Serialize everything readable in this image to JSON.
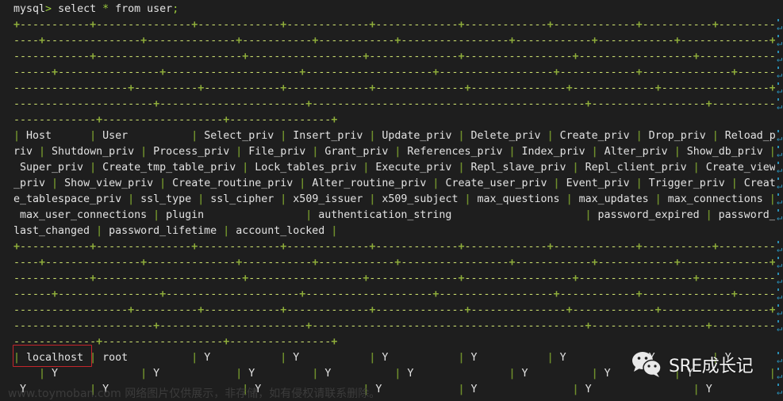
{
  "terminal": {
    "prompt": "mysql>",
    "command": "select * from user;",
    "wrap_width_chars": 120,
    "columns": [
      {
        "name": "Host",
        "width": 9,
        "value": "localhost"
      },
      {
        "name": "User",
        "width": 13,
        "value": "root"
      },
      {
        "name": "Select_priv",
        "width": 11,
        "value": "Y"
      },
      {
        "name": "Insert_priv",
        "width": 11,
        "value": "Y"
      },
      {
        "name": "Update_priv",
        "width": 11,
        "value": "Y"
      },
      {
        "name": "Delete_priv",
        "width": 11,
        "value": "Y"
      },
      {
        "name": "Create_priv",
        "width": 11,
        "value": "Y"
      },
      {
        "name": "Drop_priv",
        "width": 9,
        "value": "Y"
      },
      {
        "name": "Reload_priv",
        "width": 11,
        "value": "Y"
      },
      {
        "name": "Shutdown_priv",
        "width": 13,
        "value": "Y"
      },
      {
        "name": "Process_priv",
        "width": 12,
        "value": "Y"
      },
      {
        "name": "File_priv",
        "width": 9,
        "value": "Y"
      },
      {
        "name": "Grant_priv",
        "width": 10,
        "value": "Y"
      },
      {
        "name": "References_priv",
        "width": 15,
        "value": "Y"
      },
      {
        "name": "Index_priv",
        "width": 10,
        "value": "Y"
      },
      {
        "name": "Alter_priv",
        "width": 10,
        "value": "Y"
      },
      {
        "name": "Show_db_priv",
        "width": 12,
        "value": "Y"
      },
      {
        "name": "Super_priv",
        "width": 10,
        "value": "Y"
      },
      {
        "name": "Create_tmp_table_priv",
        "width": 21,
        "value": "Y"
      },
      {
        "name": "Lock_tables_priv",
        "width": 16,
        "value": "Y"
      },
      {
        "name": "Execute_priv",
        "width": 12,
        "value": "Y"
      },
      {
        "name": "Repl_slave_priv",
        "width": 15,
        "value": "Y"
      },
      {
        "name": "Repl_client_priv",
        "width": 16,
        "value": "Y"
      },
      {
        "name": "Create_view_priv",
        "width": 16,
        "value": "Y"
      },
      {
        "name": "Show_view_priv",
        "width": 14,
        "value": ""
      },
      {
        "name": "Create_routine_priv",
        "width": 19,
        "value": ""
      },
      {
        "name": "Alter_routine_priv",
        "width": 18,
        "value": ""
      },
      {
        "name": "Create_user_priv",
        "width": 16,
        "value": ""
      },
      {
        "name": "Event_priv",
        "width": 10,
        "value": ""
      },
      {
        "name": "Trigger_priv",
        "width": 12,
        "value": ""
      },
      {
        "name": "Create_tablespace_priv",
        "width": 22,
        "value": ""
      },
      {
        "name": "ssl_type",
        "width": 8,
        "value": ""
      },
      {
        "name": "ssl_cipher",
        "width": 10,
        "value": ""
      },
      {
        "name": "x509_issuer",
        "width": 11,
        "value": ""
      },
      {
        "name": "x509_subject",
        "width": 12,
        "value": ""
      },
      {
        "name": "max_questions",
        "width": 13,
        "value": ""
      },
      {
        "name": "max_updates",
        "width": 11,
        "value": ""
      },
      {
        "name": "max_connections",
        "width": 15,
        "value": ""
      },
      {
        "name": "max_user_connections",
        "width": 20,
        "value": ""
      },
      {
        "name": "plugin",
        "width": 21,
        "value": ""
      },
      {
        "name": "authentication_string",
        "width": 41,
        "value": ""
      },
      {
        "name": "password_expired",
        "width": 16,
        "value": ""
      },
      {
        "name": "password_last_changed",
        "width": 21,
        "value": ""
      },
      {
        "name": "password_lifetime",
        "width": 17,
        "value": ""
      },
      {
        "name": "account_locked",
        "width": 14,
        "value": ""
      }
    ],
    "visible_data_lines": 3,
    "highlighted_cell": "localhost"
  },
  "colors": {
    "background": "#1e1e1e",
    "text": "#e2e2e2",
    "border_plus": "#8fae3a",
    "border_dash": "#c9dc6e",
    "border_pipe": "#6f8f2c",
    "wrap_marker": "#2a8fb5",
    "highlight_box": "#c4252b"
  },
  "overlay": {
    "watermark": "www.toymoban.com 网络图片仅供展示，非存储，如有侵权请联系删除。",
    "brand_name": "SRE成长记",
    "brand_icon": "wechat-icon"
  }
}
